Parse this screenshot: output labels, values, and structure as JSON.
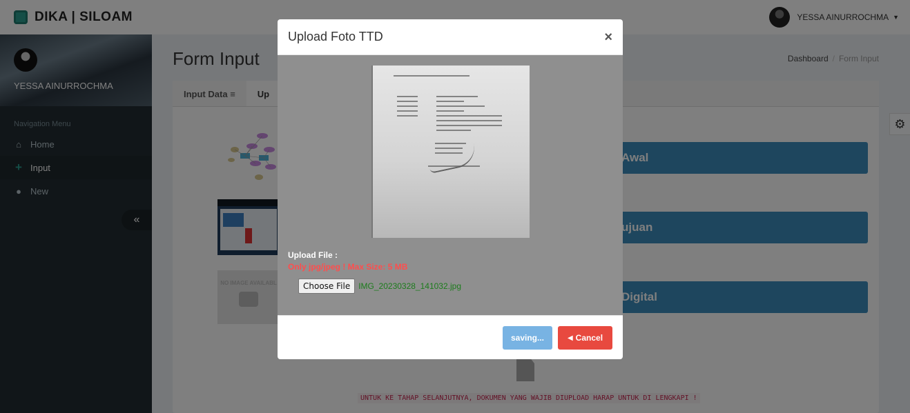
{
  "app": {
    "brand": "DIKA | SILOAM"
  },
  "topbar": {
    "user_name": "YESSA AINURROCHMA"
  },
  "sidebar": {
    "user_name": "YESSA AINURROCHMA",
    "nav_header": "Navigation Menu",
    "items": [
      {
        "label": "Home",
        "icon": "home-icon"
      },
      {
        "label": "Input",
        "icon": "plus-icon",
        "active": true
      },
      {
        "label": "New",
        "icon": "user-icon"
      }
    ]
  },
  "content": {
    "title": "Form Input",
    "breadcrumb": [
      "Dashboard",
      "Form Input"
    ],
    "tabs": [
      "Input Data",
      "Up"
    ],
    "buttons": [
      "Awal",
      "ujuan",
      "Digital"
    ],
    "no_image_text": "NO IMAGE AVAILABL",
    "warning": "UNTUK KE TAHAP SELANJUTNYA, DOKUMEN YANG WAJIB DIUPLOAD HARAP UNTUK DI LENGKAPI !"
  },
  "modal": {
    "title": "Upload Foto TTD",
    "close_label": "×",
    "upload_label": "Upload File :",
    "upload_hint": "Only jpg/jpeg ! Max Size: 5 MB",
    "choose_file_label": "Choose File",
    "file_name": "IMG_20230328_141032.jpg",
    "saving_label": "saving...",
    "cancel_label": "Cancel"
  },
  "colors": {
    "primary": "#3c8dbc",
    "danger": "#e8493f",
    "saving": "#78b3e3",
    "sidebar": "#222d32"
  }
}
